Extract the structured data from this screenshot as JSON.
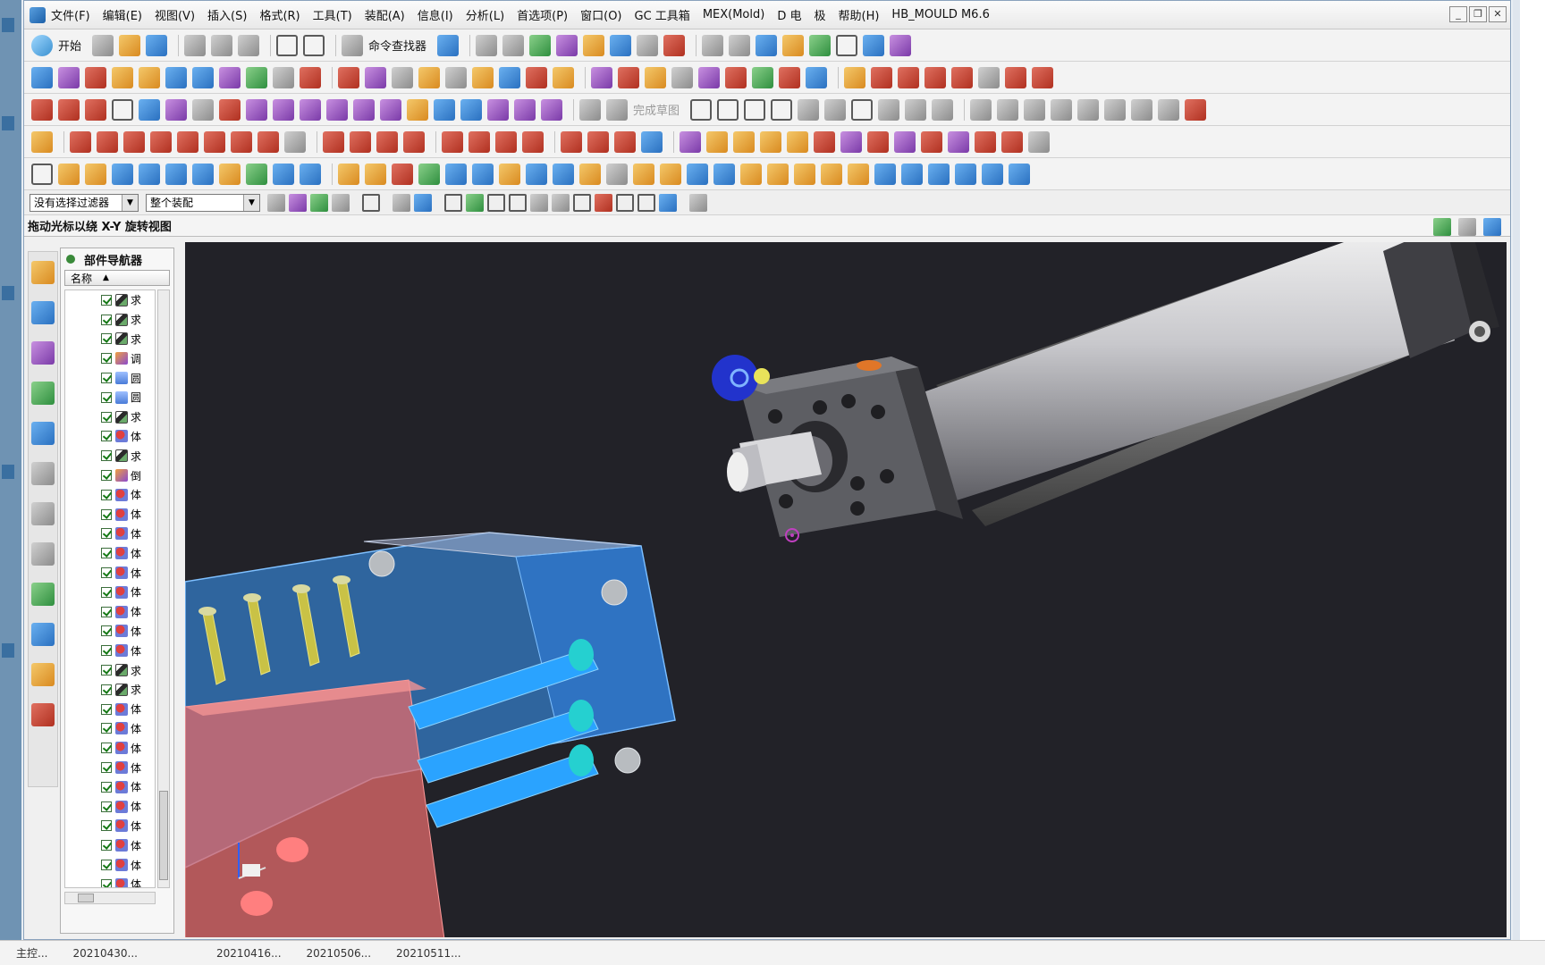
{
  "menubar": {
    "items": [
      "文件(F)",
      "编辑(E)",
      "视图(V)",
      "插入(S)",
      "格式(R)",
      "工具(T)",
      "装配(A)",
      "信息(I)",
      "分析(L)",
      "首选项(P)",
      "窗口(O)",
      "GC 工具箱",
      "MEX(Mold)",
      "D 电",
      "极",
      "帮助(H)",
      "HB_MOULD M6.6"
    ]
  },
  "toolbar": {
    "start_label": "开始",
    "command_finder_label": "命令查找器",
    "finish_sketch_label": "完成草图"
  },
  "filterbar": {
    "selection_filter": "没有选择过滤器",
    "assembly_scope": "整个装配"
  },
  "status": {
    "hint": "拖动光标以绕 X-Y 旋转视图"
  },
  "navigator": {
    "title": "部件导航器",
    "column_name": "名称",
    "rows": [
      {
        "label": "求",
        "icon": "sub"
      },
      {
        "label": "求",
        "icon": "sub"
      },
      {
        "label": "求",
        "icon": "sub"
      },
      {
        "label": "调",
        "icon": "adj"
      },
      {
        "label": "圆",
        "icon": "cyl"
      },
      {
        "label": "圆",
        "icon": "cyl"
      },
      {
        "label": "求",
        "icon": "sub"
      },
      {
        "label": "体",
        "icon": "body"
      },
      {
        "label": "求",
        "icon": "sub"
      },
      {
        "label": "倒",
        "icon": "adj"
      },
      {
        "label": "体",
        "icon": "body"
      },
      {
        "label": "体",
        "icon": "body"
      },
      {
        "label": "体",
        "icon": "body"
      },
      {
        "label": "体",
        "icon": "body"
      },
      {
        "label": "体",
        "icon": "body"
      },
      {
        "label": "体",
        "icon": "body"
      },
      {
        "label": "体",
        "icon": "body"
      },
      {
        "label": "体",
        "icon": "body"
      },
      {
        "label": "体",
        "icon": "body"
      },
      {
        "label": "求",
        "icon": "sub"
      },
      {
        "label": "求",
        "icon": "sub"
      },
      {
        "label": "体",
        "icon": "body"
      },
      {
        "label": "体",
        "icon": "body"
      },
      {
        "label": "体",
        "icon": "body"
      },
      {
        "label": "体",
        "icon": "body"
      },
      {
        "label": "体",
        "icon": "body"
      },
      {
        "label": "体",
        "icon": "body"
      },
      {
        "label": "体",
        "icon": "body"
      },
      {
        "label": "体",
        "icon": "body"
      },
      {
        "label": "体",
        "icon": "body"
      },
      {
        "label": "体",
        "icon": "body"
      }
    ]
  },
  "taskbar": {
    "items": [
      "主控...",
      "20210430...",
      "20210416...",
      "20210506...",
      "20210511..."
    ]
  },
  "colors": {
    "viewport_bg": "#222228",
    "mold_blue": "#3aa0ff",
    "mold_red": "#e06a6a",
    "cylinder_grey": "#8a8a8a",
    "highlight_blue": "#2233cc"
  }
}
